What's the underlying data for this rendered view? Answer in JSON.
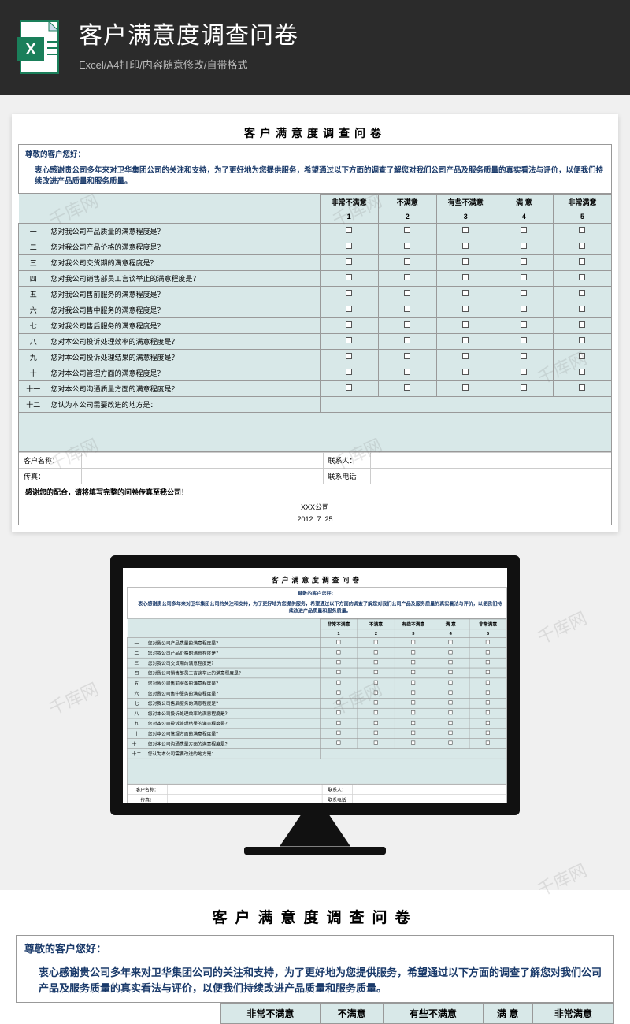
{
  "header": {
    "title": "客户满意度调查问卷",
    "subtitle": "Excel/A4打印/内容随意修改/自带格式"
  },
  "sheet": {
    "title": "客户满意度调查问卷",
    "greeting": "尊敬的客户您好：",
    "intro": "衷心感谢贵公司多年来对卫华集团公司的关注和支持，为了更好地为您提供服务，希望通过以下方面的调查了解您对我们公司产品及服务质量的真实看法与评价，以便我们持续改进产品质量和服务质量。",
    "scale_labels": [
      "非常不满意",
      "不满意",
      "有些不满意",
      "满 意",
      "非常满意"
    ],
    "scale_nums": [
      "1",
      "2",
      "3",
      "4",
      "5"
    ],
    "row_nums": [
      "一",
      "二",
      "三",
      "四",
      "五",
      "六",
      "七",
      "八",
      "九",
      "十",
      "十一",
      "十二"
    ],
    "questions": [
      "您对我公司产品质量的满意程度是？",
      "您对我公司产品价格的满意程度是？",
      "您对我公司交货期的满意程度是？",
      "您对我公司销售部员工言谈举止的满意程度是？",
      "您对我公司售前服务的满意程度是？",
      "您对我公司售中服务的满意程度是？",
      "您对我公司售后服务的满意程度是？",
      "您对本公司投诉处理效率的满意程度是？",
      "您对本公司投诉处理结果的满意程度是？",
      "您对本公司管理方面的满意程度是？",
      "您对本公司沟通质量方面的满意程度是？",
      "您认为本公司需要改进的地方是："
    ],
    "footer": {
      "customer_name_label": "客户名称：",
      "contact_label": "联系人：",
      "fax_label": "传真：",
      "phone_label": "联系电话",
      "thanks": "感谢您的配合，请将填写完整的问卷传真至我公司！",
      "company": "XXX公司",
      "date": "2012. 7. 25"
    }
  },
  "watermark": "千库网"
}
